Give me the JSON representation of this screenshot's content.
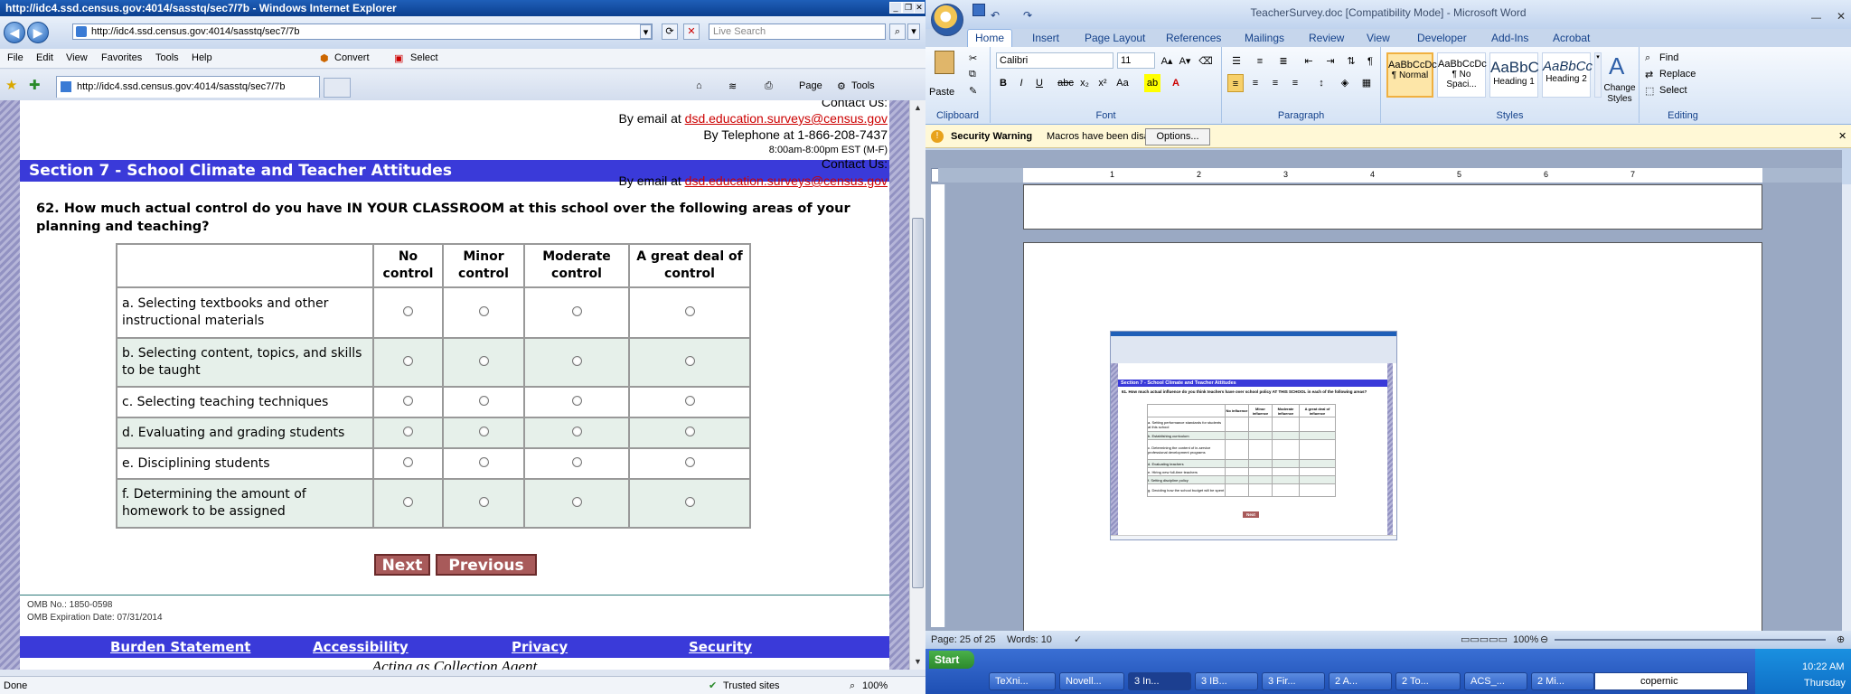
{
  "ie": {
    "title": "http://idc4.ssd.census.gov:4014/sasstq/sec7/7b - Windows Internet Explorer",
    "address": "http://idc4.ssd.census.gov:4014/sasstq/sec7/7b",
    "search_placeholder": "Live Search",
    "menu": [
      "File",
      "Edit",
      "View",
      "Favorites",
      "Tools",
      "Help"
    ],
    "convert_label": "Convert",
    "select_label": "Select",
    "tab_title": "http://idc4.ssd.census.gov:4014/sasstq/sec7/7b",
    "page_label": "Page",
    "tools_label": "Tools",
    "status_text": "Done",
    "zone_text": "Trusted sites",
    "zoom_text": "100%"
  },
  "survey": {
    "contact_us_top": "Contact Us:",
    "email_label_top": "By email at",
    "email_top": "dsd.education.surveys@census.gov",
    "phone_line": "By Telephone at 1-866-208-7437",
    "hours_line": "8:00am-8:00pm EST (M-F)",
    "section_title": "Section 7 - School Climate and Teacher Attitudes",
    "contact_us": "Contact Us:",
    "email_label": "By email at",
    "email": "dsd.education.surveys@census.gov",
    "question": "62. How much actual control do you have IN YOUR CLASSROOM at this school over the following areas of your planning and teaching?",
    "columns": [
      "No control",
      "Minor control",
      "Moderate control",
      "A great deal of control"
    ],
    "rows": [
      "a. Selecting textbooks and other instructional materials",
      "b. Selecting content, topics, and skills to be taught",
      "c. Selecting teaching techniques",
      "d. Evaluating and grading students",
      "e. Disciplining students",
      "f. Determining the amount of homework to be assigned"
    ],
    "next_label": "Next",
    "previous_label": "Previous",
    "omb_no": "OMB No.: 1850-0598",
    "omb_exp": "OMB Expiration Date: 07/31/2014",
    "footer_links": [
      "Burden Statement",
      "Accessibility",
      "Privacy",
      "Security"
    ],
    "agent_text": "Acting as Collection Agent"
  },
  "word": {
    "title": "TeacherSurvey.doc [Compatibility Mode] - Microsoft Word",
    "tabs": [
      "Home",
      "Insert",
      "Page Layout",
      "References",
      "Mailings",
      "Review",
      "View",
      "Developer",
      "Add-Ins",
      "Acrobat"
    ],
    "paste_label": "Paste",
    "clipboard_label": "Clipboard",
    "font_name": "Calibri",
    "font_size": "11",
    "font_label": "Font",
    "paragraph_label": "Paragraph",
    "styles": [
      {
        "preview": "AaBbCcDc",
        "name": "¶ Normal"
      },
      {
        "preview": "AaBbCcDc",
        "name": "¶ No Spaci..."
      },
      {
        "preview": "AaBbC",
        "name": "Heading 1"
      },
      {
        "preview": "AaBbCc",
        "name": "Heading 2"
      }
    ],
    "change_styles_label": "Change Styles",
    "styles_label": "Styles",
    "find_label": "Find",
    "replace_label": "Replace",
    "select_label": "Select",
    "editing_label": "Editing",
    "security_warning_title": "Security Warning",
    "security_warning_text": "Macros have been disabled.",
    "options_label": "Options...",
    "status_page": "Page: 25 of 25",
    "status_words": "Words: 10",
    "zoom": "100%",
    "thumb": {
      "section_title": "Section 7 - School Climate and Teacher Attitudes",
      "question": "61. How much actual influence do you think teachers have over school policy AT THIS SCHOOL in each of the following areas?",
      "columns": [
        "No influence",
        "Minor influence",
        "Moderate influence",
        "A great deal of influence"
      ],
      "rows": [
        "a. Setting performance standards for students at this school",
        "b. Establishing curriculum",
        "c. Determining the content of in-service professional development programs",
        "d. Evaluating teachers",
        "e. Hiring new full-time teachers",
        "f. Setting discipline policy",
        "g. Deciding how the school budget will be spent"
      ],
      "next_label": "Next"
    }
  },
  "taskbar": {
    "start_label": "Start",
    "tasks": [
      "TeXni...",
      "Novell...",
      "3 In...",
      "3 IB...",
      "3 Fir...",
      "2 A...",
      "2 To...",
      "ACS_...",
      "2 Mi..."
    ],
    "search_text": "copernic",
    "time": "10:22 AM",
    "day": "Thursday"
  }
}
